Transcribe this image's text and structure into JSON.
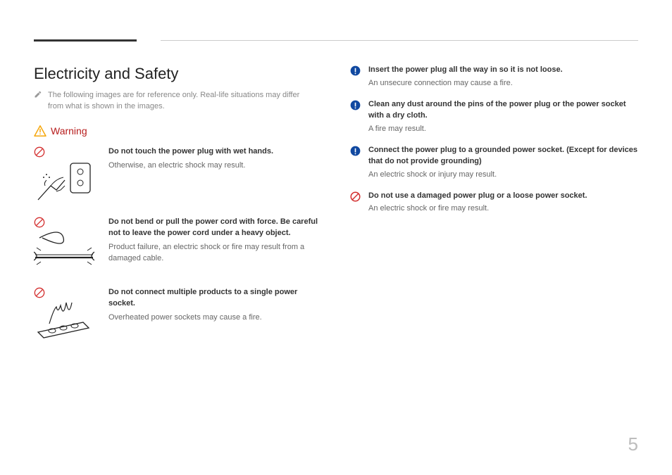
{
  "heading": "Electricity and Safety",
  "note": "The following images are for reference only. Real-life situations may differ from what is shown in the images.",
  "warning_label": "Warning",
  "left_items": [
    {
      "title": "Do not touch the power plug with wet hands.",
      "sub": "Otherwise, an electric shock may result."
    },
    {
      "title": "Do not bend or pull the power cord with force. Be careful not to leave the power cord under a heavy object.",
      "sub": "Product failure, an electric shock or fire may result from a damaged cable."
    },
    {
      "title": "Do not connect multiple products to a single power socket.",
      "sub": "Overheated power sockets may cause a fire."
    }
  ],
  "right_items": [
    {
      "icon": "notice",
      "title": "Insert the power plug all the way in so it is not loose.",
      "sub": "An unsecure connection may cause a fire."
    },
    {
      "icon": "notice",
      "title": "Clean any dust around the pins of the power plug or the power socket with a dry cloth.",
      "sub": "A fire may result."
    },
    {
      "icon": "notice",
      "title": "Connect the power plug to a grounded power socket. (Except for devices that do not provide grounding)",
      "sub": "An electric shock or injury may result."
    },
    {
      "icon": "prohibit",
      "title": "Do not use a damaged power plug or a loose power socket.",
      "sub": "An electric shock or fire may result."
    }
  ],
  "page_number": "5"
}
